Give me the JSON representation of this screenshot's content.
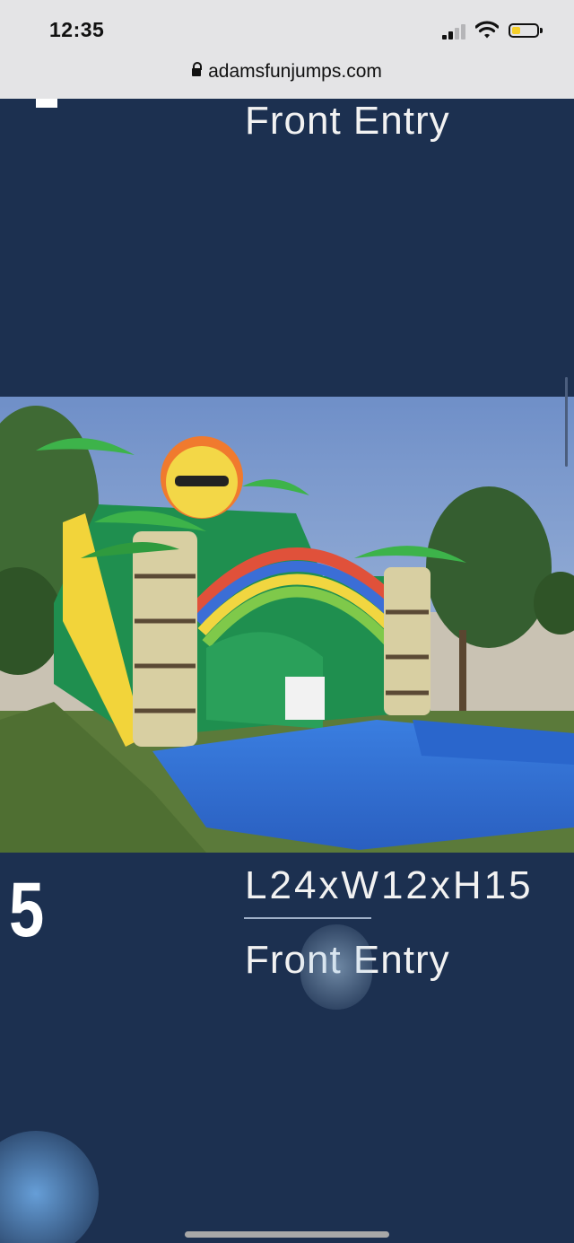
{
  "status_bar": {
    "time": "12:35",
    "url": "adamsfunjumps.com",
    "icons": [
      "lock-icon",
      "signal-icon",
      "wifi-icon",
      "battery-icon"
    ]
  },
  "previous_item": {
    "entry": "Front Entry"
  },
  "item": {
    "number": "5",
    "dimensions": "L24xW12xH15",
    "entry": "Front Entry",
    "image_alt": ""
  },
  "colors": {
    "page_bg": "#1c3050",
    "status_bg": "#e4e4e6",
    "text": "#f2f2f2",
    "battery": "#f5cf2a"
  }
}
